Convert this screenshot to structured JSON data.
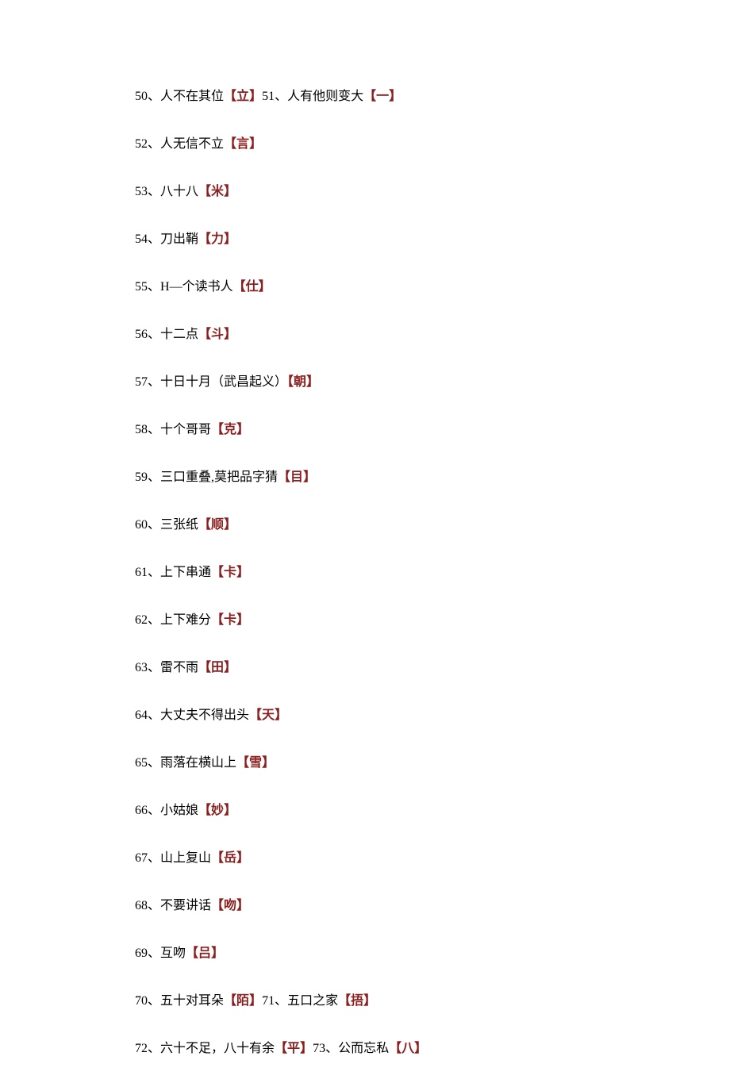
{
  "lines": [
    [
      {
        "num": "50",
        "clue": "人不在其位",
        "answer": "立"
      },
      {
        "num": "51",
        "clue": "人有他则变大",
        "answer": "一"
      }
    ],
    [
      {
        "num": "52",
        "clue": "人无信不立",
        "answer": "言"
      }
    ],
    [
      {
        "num": "53",
        "clue": "八十八",
        "answer": "米"
      }
    ],
    [
      {
        "num": "54",
        "clue": "刀出鞘",
        "answer": "力"
      }
    ],
    [
      {
        "num": "55",
        "clue": "H—个读书人",
        "answer": "仕"
      }
    ],
    [
      {
        "num": "56",
        "clue": "十二点",
        "answer": "斗"
      }
    ],
    [
      {
        "num": "57",
        "clue": "十日十月（武昌起义）",
        "answer": "朝"
      }
    ],
    [
      {
        "num": "58",
        "clue": "十个哥哥",
        "answer": "克"
      }
    ],
    [
      {
        "num": "59",
        "clue": "三口重叠,莫把品字猜",
        "answer": "目"
      }
    ],
    [
      {
        "num": "60",
        "clue": "三张纸",
        "answer": "顺"
      }
    ],
    [
      {
        "num": "61",
        "clue": "上下串通",
        "answer": "卡"
      }
    ],
    [
      {
        "num": "62",
        "clue": "上下难分",
        "answer": "卡"
      }
    ],
    [
      {
        "num": "63",
        "clue": "雷不雨",
        "answer": "田"
      }
    ],
    [
      {
        "num": "64",
        "clue": "大丈夫不得出头",
        "answer": "天"
      }
    ],
    [
      {
        "num": "65",
        "clue": "雨落在横山上",
        "answer": "雪"
      }
    ],
    [
      {
        "num": "66",
        "clue": "小姑娘",
        "answer": "妙"
      }
    ],
    [
      {
        "num": "67",
        "clue": "山上复山",
        "answer": "岳"
      }
    ],
    [
      {
        "num": "68",
        "clue": "不要讲话",
        "answer": "吻"
      }
    ],
    [
      {
        "num": "69",
        "clue": "互吻",
        "answer": "吕"
      }
    ],
    [
      {
        "num": "70",
        "clue": "五十对耳朵",
        "answer": "陌"
      },
      {
        "num": "71",
        "clue": "五口之家",
        "answer": "捂"
      }
    ],
    [
      {
        "num": "72",
        "clue": "六十不足，八十有余",
        "answer": "平"
      },
      {
        "num": "73",
        "clue": "公而忘私",
        "answer": "八"
      }
    ]
  ]
}
